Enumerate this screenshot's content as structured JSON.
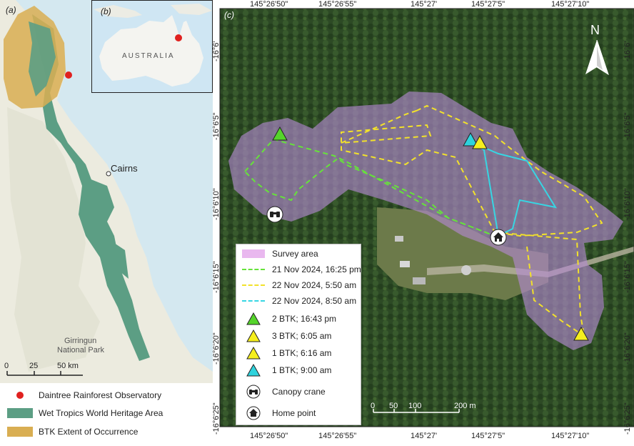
{
  "panel_a": {
    "label": "(a)",
    "city": "Cairns",
    "park": [
      "Girringun",
      "National Park"
    ],
    "scale": {
      "ticks": [
        "0",
        "25",
        "50 km"
      ]
    },
    "legend": [
      {
        "label": "Daintree Rainforest Observatory",
        "color": "#e0211f"
      },
      {
        "label": "Wet Tropics World Heritage Area",
        "color": "#5c9e84"
      },
      {
        "label": "BTK Extent of Occurrence",
        "color": "#d9ae52"
      }
    ]
  },
  "panel_b": {
    "label": "(b)",
    "country": "AUSTRALIA"
  },
  "panel_c": {
    "label": "(c)",
    "north": "N",
    "x_ticks": [
      "145°26'50\"",
      "145°26'55\"",
      "145°27'",
      "145°27'5\"",
      "145°27'10\""
    ],
    "y_ticks": [
      "-16°6'",
      "-16°6'5\"",
      "-16°6'10\"",
      "-16°6'15\"",
      "-16°6'20\"",
      "-16°6'25\""
    ],
    "scale": {
      "ticks": [
        "0",
        "50",
        "100",
        "200 m"
      ]
    },
    "legend": [
      {
        "label": "Survey area",
        "kind": "area",
        "color": "#e9b8ef"
      },
      {
        "label": "21 Nov 2024, 16:25 pm",
        "kind": "dash",
        "color": "#66e33a"
      },
      {
        "label": "22 Nov 2024, 5:50 am",
        "kind": "dash",
        "color": "#f2e12b"
      },
      {
        "label": "22 Nov 2024, 8:50 am",
        "kind": "dash",
        "color": "#37d6e3"
      },
      {
        "label": "2 BTK; 16:43 pm",
        "kind": "triangle",
        "color": "#55d42b"
      },
      {
        "label": "3 BTK; 6:05 am",
        "kind": "triangle",
        "color": "#f5ee1d"
      },
      {
        "label": "1 BTK; 6:16 am",
        "kind": "triangle",
        "color": "#f5ee1d"
      },
      {
        "label": "1 BTK; 9:00 am",
        "kind": "triangle",
        "color": "#2ed3dd"
      },
      {
        "label": "Canopy crane",
        "kind": "binoculars-icon"
      },
      {
        "label": "Home point",
        "kind": "home-icon"
      }
    ]
  }
}
